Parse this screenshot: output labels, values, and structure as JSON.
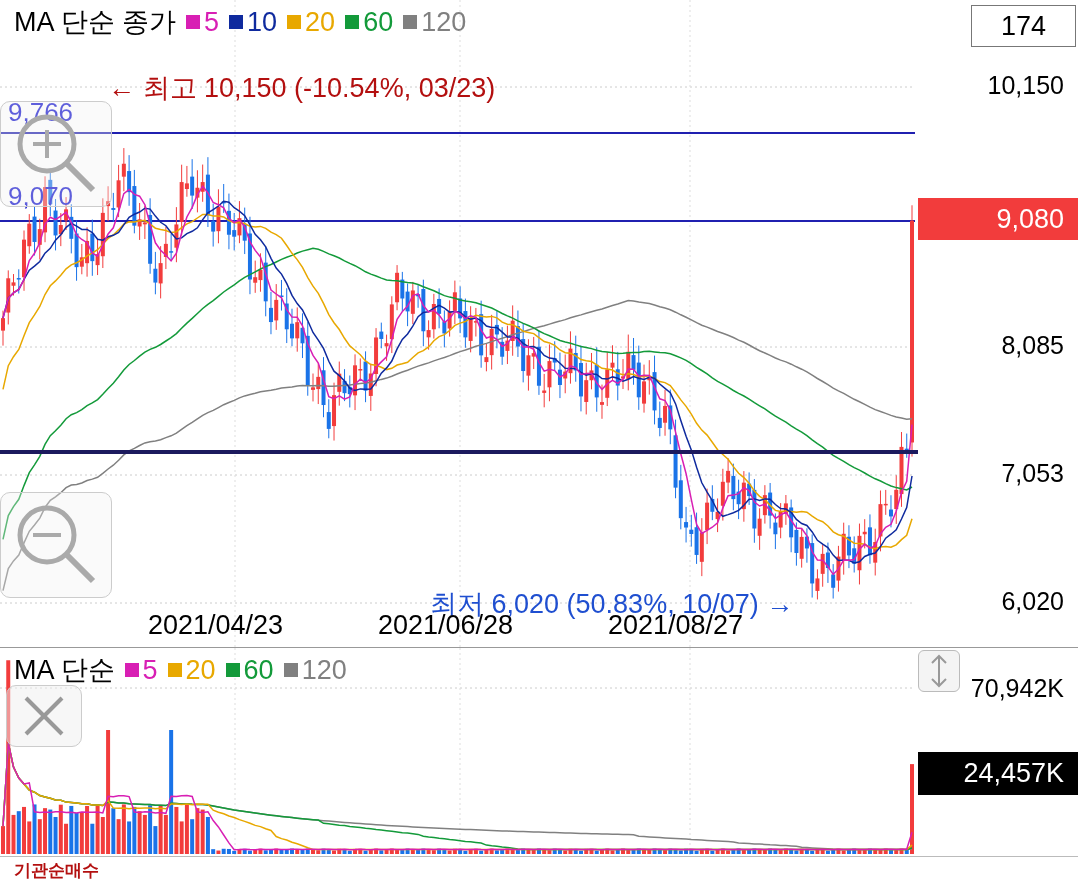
{
  "price_panel": {
    "legend_title": "MA 단순 종가",
    "ma_legend": [
      {
        "label": "5",
        "color": "#d81fb4"
      },
      {
        "label": "10",
        "color": "#0f2a9e"
      },
      {
        "label": "20",
        "color": "#e8a800"
      },
      {
        "label": "60",
        "color": "#139a3a"
      },
      {
        "label": "120",
        "color": "#808080"
      }
    ],
    "period_box": "174",
    "high_annotation": "← 최고 10,150 (-10.54%, 03/23)",
    "low_annotation": "최저 6,020 (50.83%, 10/07) →",
    "line_labels": [
      "9,766",
      "9,070"
    ],
    "axis_labels": [
      "10,150",
      "8,085",
      "7,053",
      "6,020"
    ],
    "current_price": "9,080",
    "dates": [
      "2021/04/23",
      "2021/06/28",
      "2021/08/27"
    ]
  },
  "volume_panel": {
    "legend_title": "MA 단순",
    "ma_legend": [
      {
        "label": "5",
        "color": "#d81fb4"
      },
      {
        "label": "20",
        "color": "#e8a800"
      },
      {
        "label": "60",
        "color": "#139a3a"
      },
      {
        "label": "120",
        "color": "#808080"
      }
    ],
    "axis_label": "70,942K",
    "current_volume": "24,457K"
  },
  "next_panel": {
    "title": "기관순매수"
  }
}
